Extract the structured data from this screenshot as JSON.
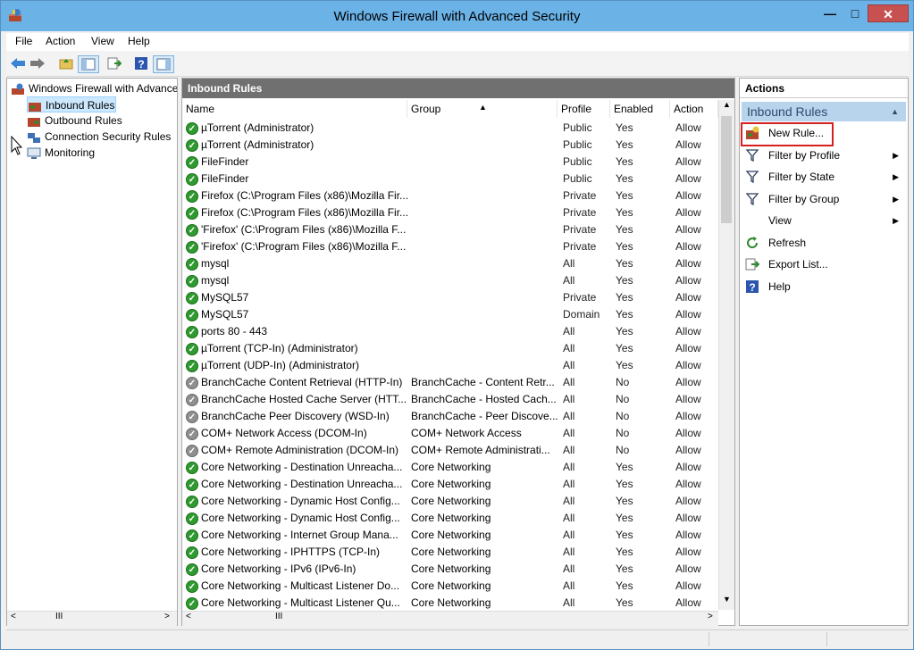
{
  "window": {
    "title": "Windows Firewall with Advanced Security",
    "min": "—",
    "max": "□",
    "close": "✕"
  },
  "menu": [
    "File",
    "Action",
    "View",
    "Help"
  ],
  "toolbar": [
    "back-icon",
    "forward-icon",
    "up-folder-icon",
    "show-hide-tree-icon",
    "export-icon",
    "help-icon",
    "show-hide-action-icon"
  ],
  "tree": {
    "root": "Windows Firewall with Advance",
    "items": [
      "Inbound Rules",
      "Outbound Rules",
      "Connection Security Rules",
      "Monitoring"
    ],
    "scroll_thumb": "III"
  },
  "center": {
    "header": "Inbound Rules",
    "columns": [
      "Name",
      "Group",
      "Profile",
      "Enabled",
      "Action"
    ],
    "scroll_thumb": "III",
    "rows": [
      {
        "n": "µTorrent (Administrator)",
        "g": "",
        "p": "Public",
        "e": "Yes",
        "a": "Allow",
        "on": true
      },
      {
        "n": "µTorrent (Administrator)",
        "g": "",
        "p": "Public",
        "e": "Yes",
        "a": "Allow",
        "on": true
      },
      {
        "n": "FileFinder",
        "g": "",
        "p": "Public",
        "e": "Yes",
        "a": "Allow",
        "on": true
      },
      {
        "n": "FileFinder",
        "g": "",
        "p": "Public",
        "e": "Yes",
        "a": "Allow",
        "on": true
      },
      {
        "n": "Firefox (C:\\Program Files (x86)\\Mozilla Fir...",
        "g": "",
        "p": "Private",
        "e": "Yes",
        "a": "Allow",
        "on": true
      },
      {
        "n": "Firefox (C:\\Program Files (x86)\\Mozilla Fir...",
        "g": "",
        "p": "Private",
        "e": "Yes",
        "a": "Allow",
        "on": true
      },
      {
        "n": "'Firefox' (C:\\Program Files (x86)\\Mozilla F...",
        "g": "",
        "p": "Private",
        "e": "Yes",
        "a": "Allow",
        "on": true
      },
      {
        "n": "'Firefox' (C:\\Program Files (x86)\\Mozilla F...",
        "g": "",
        "p": "Private",
        "e": "Yes",
        "a": "Allow",
        "on": true
      },
      {
        "n": "mysql",
        "g": "",
        "p": "All",
        "e": "Yes",
        "a": "Allow",
        "on": true
      },
      {
        "n": "mysql",
        "g": "",
        "p": "All",
        "e": "Yes",
        "a": "Allow",
        "on": true
      },
      {
        "n": "MySQL57",
        "g": "",
        "p": "Private",
        "e": "Yes",
        "a": "Allow",
        "on": true
      },
      {
        "n": "MySQL57",
        "g": "",
        "p": "Domain",
        "e": "Yes",
        "a": "Allow",
        "on": true
      },
      {
        "n": "ports 80 - 443",
        "g": "",
        "p": "All",
        "e": "Yes",
        "a": "Allow",
        "on": true
      },
      {
        "n": "µTorrent (TCP-In) (Administrator)",
        "g": "",
        "p": "All",
        "e": "Yes",
        "a": "Allow",
        "on": true
      },
      {
        "n": "µTorrent (UDP-In) (Administrator)",
        "g": "",
        "p": "All",
        "e": "Yes",
        "a": "Allow",
        "on": true
      },
      {
        "n": "BranchCache Content Retrieval (HTTP-In)",
        "g": "BranchCache - Content Retr...",
        "p": "All",
        "e": "No",
        "a": "Allow",
        "on": false
      },
      {
        "n": "BranchCache Hosted Cache Server (HTT...",
        "g": "BranchCache - Hosted Cach...",
        "p": "All",
        "e": "No",
        "a": "Allow",
        "on": false
      },
      {
        "n": "BranchCache Peer Discovery (WSD-In)",
        "g": "BranchCache - Peer Discove...",
        "p": "All",
        "e": "No",
        "a": "Allow",
        "on": false
      },
      {
        "n": "COM+ Network Access (DCOM-In)",
        "g": "COM+ Network Access",
        "p": "All",
        "e": "No",
        "a": "Allow",
        "on": false
      },
      {
        "n": "COM+ Remote Administration (DCOM-In)",
        "g": "COM+ Remote Administrati...",
        "p": "All",
        "e": "No",
        "a": "Allow",
        "on": false
      },
      {
        "n": "Core Networking - Destination Unreacha...",
        "g": "Core Networking",
        "p": "All",
        "e": "Yes",
        "a": "Allow",
        "on": true
      },
      {
        "n": "Core Networking - Destination Unreacha...",
        "g": "Core Networking",
        "p": "All",
        "e": "Yes",
        "a": "Allow",
        "on": true
      },
      {
        "n": "Core Networking - Dynamic Host Config...",
        "g": "Core Networking",
        "p": "All",
        "e": "Yes",
        "a": "Allow",
        "on": true
      },
      {
        "n": "Core Networking - Dynamic Host Config...",
        "g": "Core Networking",
        "p": "All",
        "e": "Yes",
        "a": "Allow",
        "on": true
      },
      {
        "n": "Core Networking - Internet Group Mana...",
        "g": "Core Networking",
        "p": "All",
        "e": "Yes",
        "a": "Allow",
        "on": true
      },
      {
        "n": "Core Networking - IPHTTPS (TCP-In)",
        "g": "Core Networking",
        "p": "All",
        "e": "Yes",
        "a": "Allow",
        "on": true
      },
      {
        "n": "Core Networking - IPv6 (IPv6-In)",
        "g": "Core Networking",
        "p": "All",
        "e": "Yes",
        "a": "Allow",
        "on": true
      },
      {
        "n": "Core Networking - Multicast Listener Do...",
        "g": "Core Networking",
        "p": "All",
        "e": "Yes",
        "a": "Allow",
        "on": true
      },
      {
        "n": "Core Networking - Multicast Listener Qu...",
        "g": "Core Networking",
        "p": "All",
        "e": "Yes",
        "a": "Allow",
        "on": true
      }
    ]
  },
  "actions": {
    "header": "Actions",
    "section": "Inbound Rules",
    "items": [
      {
        "label": "New Rule...",
        "icon": "new-rule-icon",
        "sub": false
      },
      {
        "label": "Filter by Profile",
        "icon": "filter-icon",
        "sub": true
      },
      {
        "label": "Filter by State",
        "icon": "filter-icon",
        "sub": true
      },
      {
        "label": "Filter by Group",
        "icon": "filter-icon",
        "sub": true
      },
      {
        "label": "View",
        "icon": "",
        "sub": true
      },
      {
        "label": "Refresh",
        "icon": "refresh-icon",
        "sub": false
      },
      {
        "label": "Export List...",
        "icon": "export-list-icon",
        "sub": false
      },
      {
        "label": "Help",
        "icon": "help-icon",
        "sub": false
      }
    ]
  },
  "colors": {
    "titlebar": "#6bb2e6",
    "highlight": "#d62020",
    "enabled": "#2f9a2f",
    "disabled": "#8f8f8f"
  }
}
